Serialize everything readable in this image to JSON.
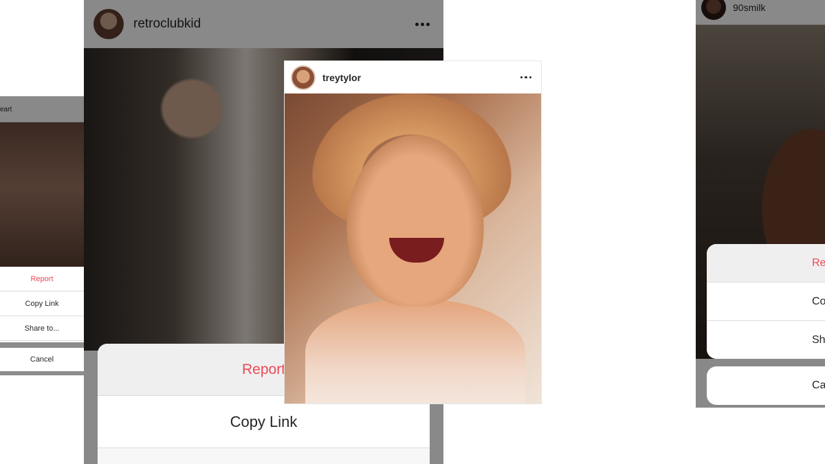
{
  "left_screen": {
    "header_text": "eart",
    "actions": [
      "Report",
      "Copy Link",
      "Share to..."
    ],
    "cancel": "Cancel"
  },
  "middle_screen": {
    "username": "retroclubkid",
    "actions": [
      "Report",
      "Copy Link"
    ]
  },
  "center_post": {
    "username": "treytylor"
  },
  "right_screen": {
    "username": "90smilk",
    "actions": [
      "Re",
      "Cop",
      "Shar"
    ],
    "cancel": "Ca"
  },
  "colors": {
    "report_red": "#ed4956",
    "text_dark": "#262626",
    "sheet_bg": "#f7f7f7",
    "overlay": "rgba(0,0,0,0.45)"
  },
  "icons": [
    "more-options-icon"
  ]
}
